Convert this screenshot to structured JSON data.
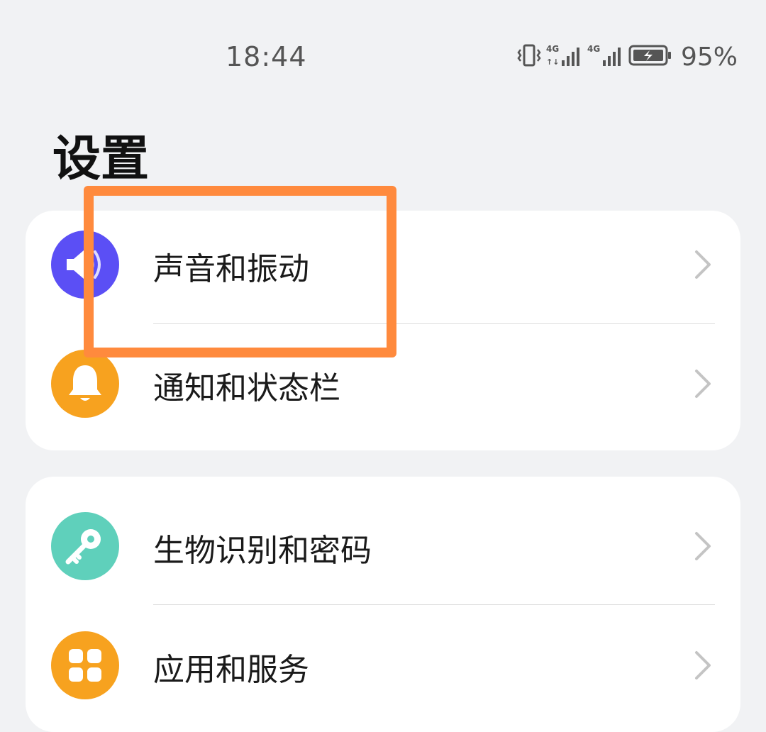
{
  "status_bar": {
    "time": "18:44",
    "battery_percent": "95%",
    "icons": [
      "vibrate-icon",
      "signal-4g-icon",
      "signal-4g-icon",
      "battery-charging-icon"
    ]
  },
  "page": {
    "title": "设置"
  },
  "groups": [
    {
      "items": [
        {
          "label": "声音和振动",
          "icon": "speaker-icon",
          "icon_color": "#5b4ff5"
        },
        {
          "label": "通知和状态栏",
          "icon": "bell-icon",
          "icon_color": "#f7a21f"
        }
      ]
    },
    {
      "items": [
        {
          "label": "生物识别和密码",
          "icon": "key-icon",
          "icon_color": "#5fd0bb"
        },
        {
          "label": "应用和服务",
          "icon": "apps-grid-icon",
          "icon_color": "#f7a21f"
        }
      ]
    }
  ],
  "highlight": {
    "color": "#ff8a3d",
    "target": "声音和振动"
  }
}
